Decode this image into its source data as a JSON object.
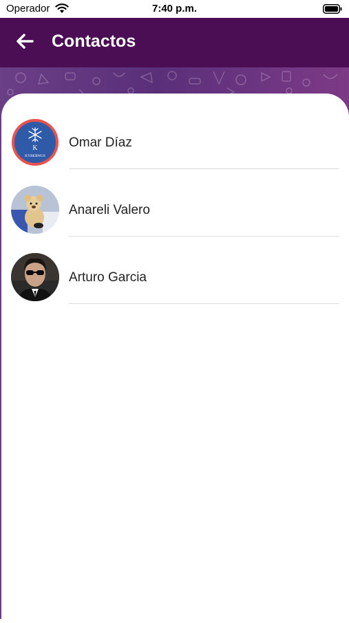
{
  "status_bar": {
    "carrier": "Operador",
    "time": "7:40 p.m."
  },
  "app_bar": {
    "title": "Contactos",
    "background": "#4b0e55"
  },
  "contacts": [
    {
      "name": "Omar Díaz",
      "avatar_text": "KYBERNUS"
    },
    {
      "name": "Anareli Valero"
    },
    {
      "name": "Arturo Garcia"
    }
  ],
  "icons": {
    "back": "arrow-left-icon",
    "wifi": "wifi-icon",
    "battery": "battery-icon"
  }
}
